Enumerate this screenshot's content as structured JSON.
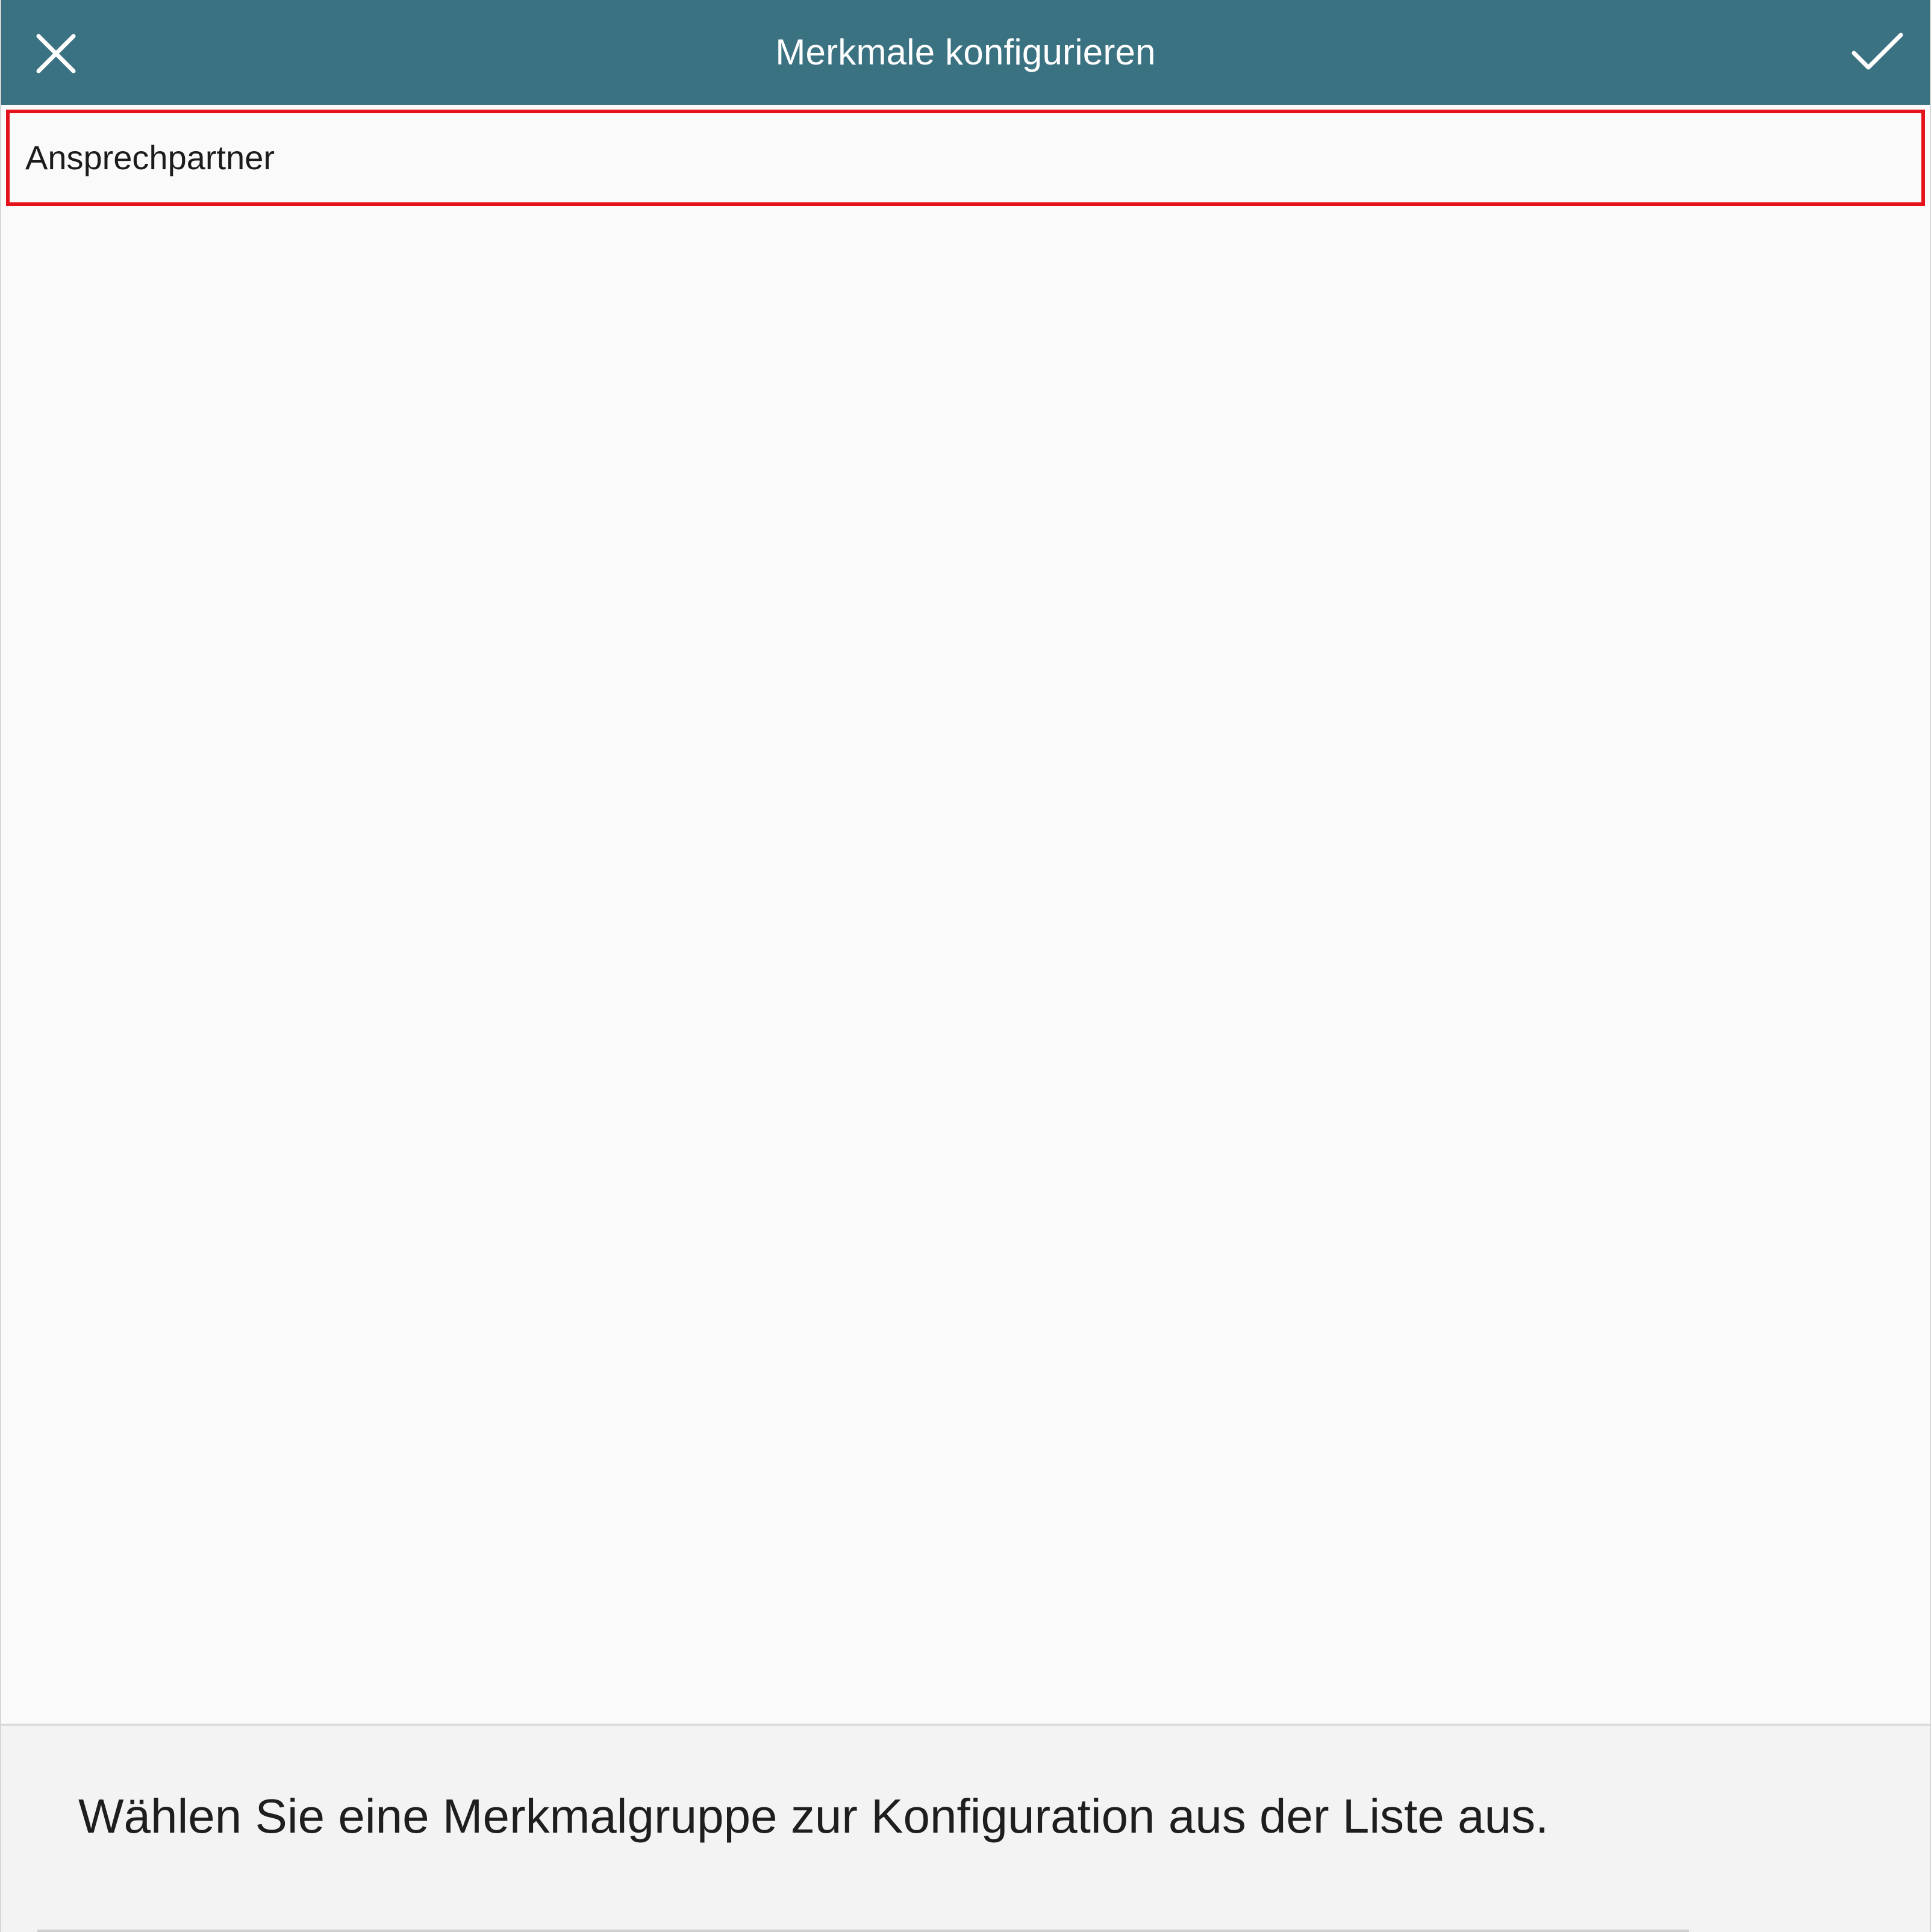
{
  "header": {
    "title": "Merkmale konfigurieren",
    "close_icon": "close-icon",
    "confirm_icon": "checkmark-icon",
    "background_color": "#3b7282"
  },
  "groups": {
    "items": [
      {
        "label": "Ansprechpartner",
        "selected": true
      }
    ],
    "highlight_color": "#e6121b"
  },
  "footer": {
    "hint": "Wählen Sie eine Merkmalgruppe zur Konfiguration aus der Liste aus."
  }
}
